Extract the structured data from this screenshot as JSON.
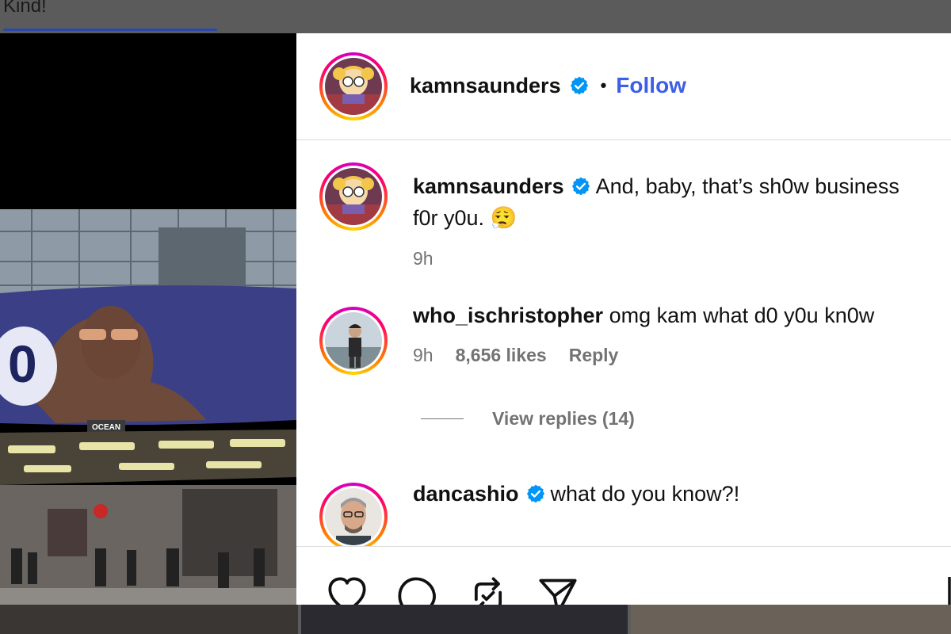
{
  "backdrop": {
    "partial_text": "Kind!"
  },
  "post": {
    "author": "kamnsaunders",
    "separator": "•",
    "follow_label": "Follow",
    "photo_sign": "OCEAN",
    "screen_text": "0"
  },
  "comments": [
    {
      "username": "kamnsaunders",
      "verified": true,
      "text": "And, baby, that’s sh0w business",
      "text_cont": "f0r y0u. 😮‍💨",
      "time": "9h"
    },
    {
      "username": "who_ischristopher",
      "verified": false,
      "text": "omg kam what d0 y0u kn0w",
      "time": "9h",
      "likes": "8,656 likes",
      "reply_label": "Reply",
      "view_replies": "View replies (14)"
    },
    {
      "username": "dancashio",
      "verified": true,
      "text": "what do you know?!"
    }
  ],
  "colors": {
    "follow": "#3d5ee8",
    "verified": "#0095f6",
    "muted": "#737373"
  },
  "icons": [
    "heart-icon",
    "comment-icon",
    "share-icon",
    "send-icon",
    "bookmark-icon",
    "verified-badge-icon"
  ]
}
